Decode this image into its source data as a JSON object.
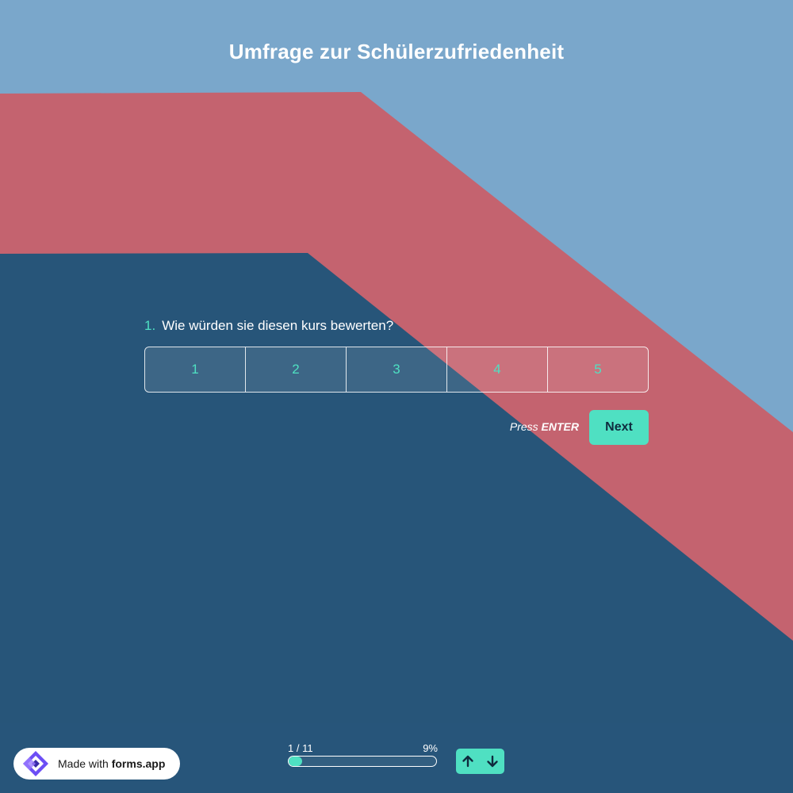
{
  "colors": {
    "accent": "#4fe0c2",
    "sky": "#7aa7cb",
    "red_band": "#c4636f",
    "navy": "#275579"
  },
  "form": {
    "title": "Umfrage zur Schülerzufriedenheit"
  },
  "question": {
    "number": "1.",
    "text": "Wie würden sie diesen kurs bewerten?",
    "options": [
      "1",
      "2",
      "3",
      "4",
      "5"
    ]
  },
  "actions": {
    "press_label": "Press",
    "press_key": "ENTER",
    "next_label": "Next"
  },
  "footer": {
    "badge_prefix": "Made with",
    "badge_brand": "forms.app",
    "progress_count": "1 / 11",
    "progress_percent_label": "9%",
    "progress_value": 0.09,
    "nav_icons": [
      "arrow-up-icon",
      "arrow-down-icon"
    ]
  }
}
